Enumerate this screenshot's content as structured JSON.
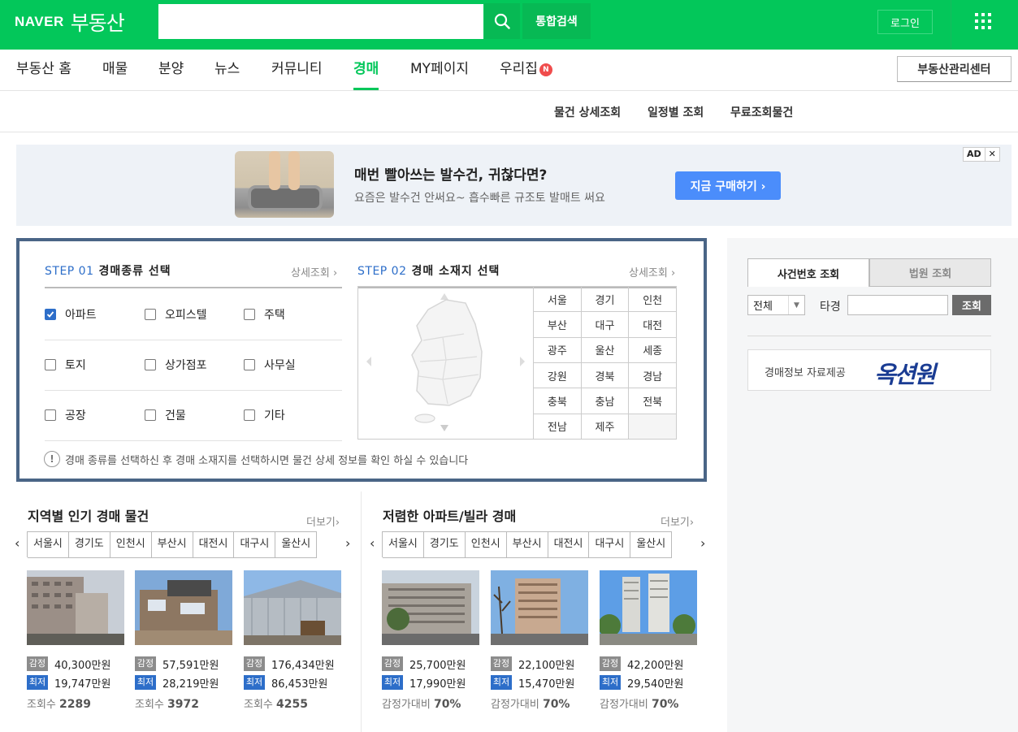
{
  "header": {
    "logo_naver": "NAVER",
    "logo_brand": "부동산",
    "search_placeholder": "",
    "unified_search": "통합검색",
    "login": "로그인"
  },
  "mainnav": {
    "items": [
      "부동산 홈",
      "매물",
      "분양",
      "뉴스",
      "커뮤니티",
      "경매",
      "MY페이지",
      "우리집"
    ],
    "active": "경매",
    "badge": "N",
    "mgmt_center": "부동산관리센터"
  },
  "subnav": [
    "물건 상세조회",
    "일정별 조회",
    "무료조회물건"
  ],
  "ad": {
    "title": "매번 빨아쓰는 발수건, 귀찮다면?",
    "desc": "요즘은 발수건 안써요~ 흡수빠른 규조토 발매트 써요",
    "cta": "지금 구매하기 ›",
    "badge": "AD",
    "close": "✕"
  },
  "step1": {
    "label": "STEP 01",
    "title": "경매종류 선택",
    "detail": "상세조회",
    "types": [
      [
        {
          "name": "아파트",
          "checked": true
        },
        {
          "name": "오피스텔",
          "checked": false
        },
        {
          "name": "주택",
          "checked": false
        }
      ],
      [
        {
          "name": "토지",
          "checked": false
        },
        {
          "name": "상가점포",
          "checked": false
        },
        {
          "name": "사무실",
          "checked": false
        }
      ],
      [
        {
          "name": "공장",
          "checked": false
        },
        {
          "name": "건물",
          "checked": false
        },
        {
          "name": "기타",
          "checked": false
        }
      ]
    ]
  },
  "step2": {
    "label": "STEP 02",
    "title": "경매 소재지 선택",
    "detail": "상세조회",
    "regions": [
      "서울",
      "경기",
      "인천",
      "부산",
      "대구",
      "대전",
      "광주",
      "울산",
      "세종",
      "강원",
      "경북",
      "경남",
      "충북",
      "충남",
      "전북",
      "전남",
      "제주",
      ""
    ]
  },
  "info_text": "경매 종류를 선택하신 후 경매 소재지를 선택하시면 물건 상세 정보를 확인 하실 수 있습니다",
  "popular": {
    "title": "지역별 인기 경매 물건",
    "more": "더보기",
    "tabs": [
      "서울시",
      "경기도",
      "인천시",
      "부산시",
      "대전시",
      "대구시",
      "울산시"
    ],
    "items": [
      {
        "appraisal": "40,300만원",
        "minimum": "19,747만원",
        "views_label": "조회수",
        "views": "2289"
      },
      {
        "appraisal": "57,591만원",
        "minimum": "28,219만원",
        "views_label": "조회수",
        "views": "3972"
      },
      {
        "appraisal": "176,434만원",
        "minimum": "86,453만원",
        "views_label": "조회수",
        "views": "4255"
      }
    ]
  },
  "cheap": {
    "title": "저렴한 아파트/빌라 경매",
    "more": "더보기",
    "tabs": [
      "서울시",
      "경기도",
      "인천시",
      "부산시",
      "대전시",
      "대구시",
      "울산시"
    ],
    "items": [
      {
        "appraisal": "25,700만원",
        "minimum": "17,990만원",
        "ratio_label": "감정가대비",
        "ratio": "70%"
      },
      {
        "appraisal": "22,100만원",
        "minimum": "15,470만원",
        "ratio_label": "감정가대비",
        "ratio": "70%"
      },
      {
        "appraisal": "42,200만원",
        "minimum": "29,540만원",
        "ratio_label": "감정가대비",
        "ratio": "70%"
      }
    ]
  },
  "price_tags": {
    "appraisal": "감정",
    "minimum": "최저"
  },
  "right": {
    "tab_case": "사건번호 조회",
    "tab_court": "법원 조회",
    "select_value": "전체",
    "tagyeong": "타경",
    "query": "조회",
    "provider_label": "경매정보 자료제공",
    "provider_logo": "옥션원"
  },
  "colors": {
    "brand": "#03c75a",
    "accent_blue": "#2d6ec9",
    "step_border": "#4a6586"
  }
}
